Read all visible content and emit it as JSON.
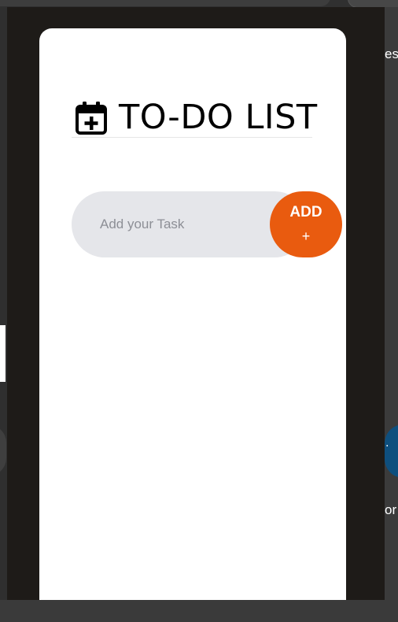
{
  "app": {
    "title": "TO-DO LIST",
    "title_icon": "calendar-plus-icon"
  },
  "task_input": {
    "placeholder": "Add your Task",
    "value": ""
  },
  "add_button": {
    "label": "ADD",
    "symbol": "+"
  },
  "background": {
    "right_fragments": [
      "es",
      "or"
    ],
    "right_button_glyph": "·"
  },
  "colors": {
    "accent": "#e95b0f",
    "card": "#ffffff",
    "input_bg": "#e5e6ea",
    "backdrop": "#1e1b18"
  }
}
